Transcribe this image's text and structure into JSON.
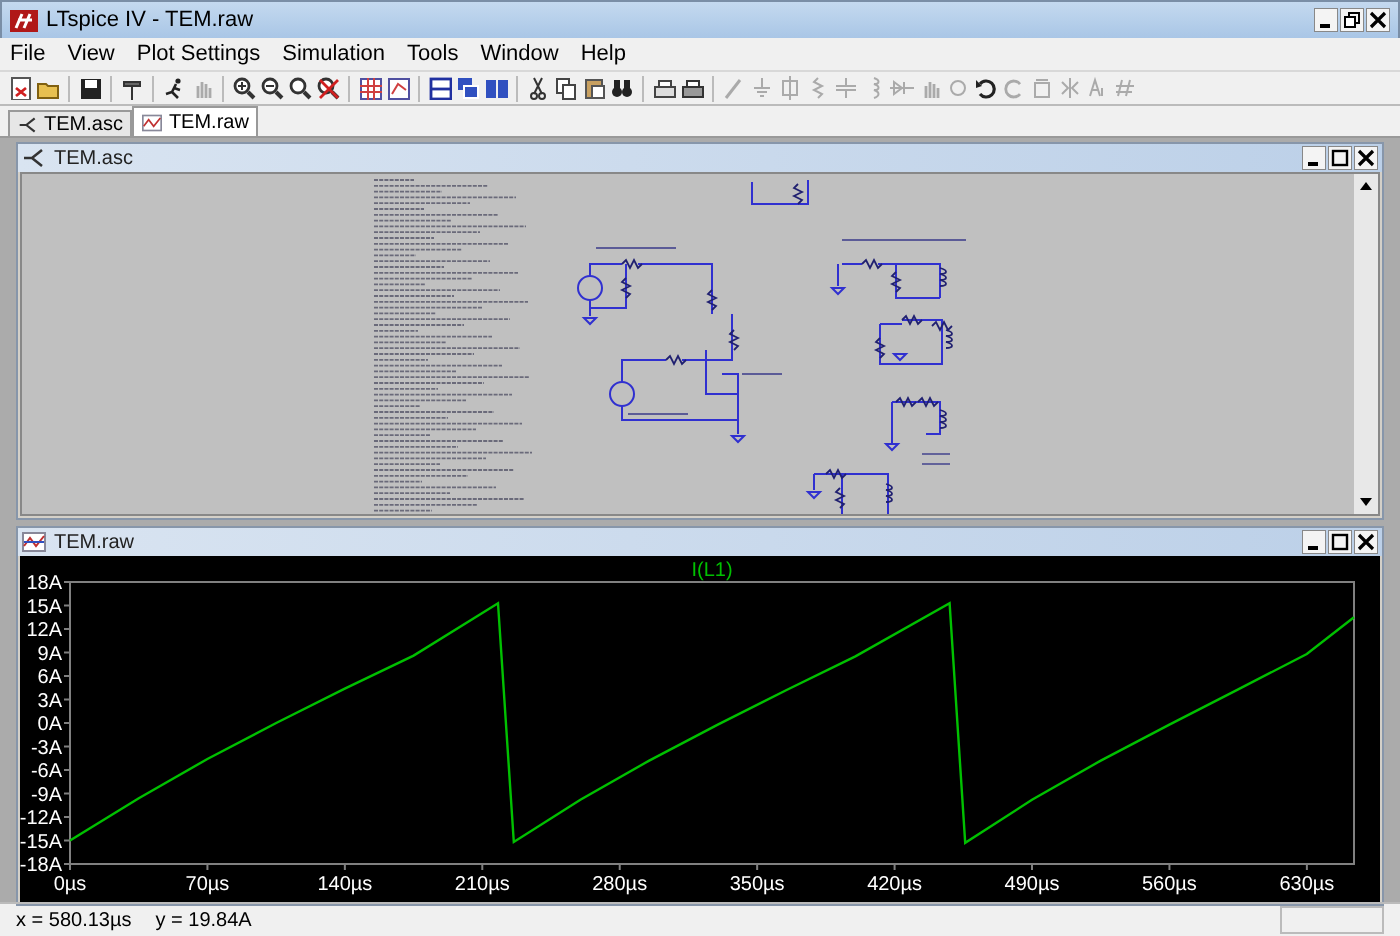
{
  "window": {
    "title": "LTspice IV - TEM.raw"
  },
  "menu": [
    {
      "label": "File"
    },
    {
      "label": "View"
    },
    {
      "label": "Plot Settings"
    },
    {
      "label": "Simulation"
    },
    {
      "label": "Tools"
    },
    {
      "label": "Window"
    },
    {
      "label": "Help"
    }
  ],
  "tabs": [
    {
      "label": "TEM.asc",
      "kind": "schematic",
      "selected": false
    },
    {
      "label": "TEM.raw",
      "kind": "plot",
      "selected": true
    }
  ],
  "schematic_window": {
    "title": "TEM.asc"
  },
  "plot_window": {
    "title": "TEM.raw",
    "chart_data": {
      "type": "line",
      "xlim": [
        0,
        654
      ],
      "ylim": [
        -18,
        18
      ],
      "xticks": [
        {
          "value": 0,
          "label": "0µs"
        },
        {
          "value": 70,
          "label": "70µs"
        },
        {
          "value": 140,
          "label": "140µs"
        },
        {
          "value": 210,
          "label": "210µs"
        },
        {
          "value": 280,
          "label": "280µs"
        },
        {
          "value": 350,
          "label": "350µs"
        },
        {
          "value": 420,
          "label": "420µs"
        },
        {
          "value": 490,
          "label": "490µs"
        },
        {
          "value": 560,
          "label": "560µs"
        },
        {
          "value": 630,
          "label": "630µs"
        }
      ],
      "yticks": [
        {
          "value": 18,
          "label": "18A"
        },
        {
          "value": 15,
          "label": "15A"
        },
        {
          "value": 12,
          "label": "12A"
        },
        {
          "value": 9,
          "label": "9A"
        },
        {
          "value": 6,
          "label": "6A"
        },
        {
          "value": 3,
          "label": "3A"
        },
        {
          "value": 0,
          "label": "0A"
        },
        {
          "value": -3,
          "label": "-3A"
        },
        {
          "value": -6,
          "label": "-6A"
        },
        {
          "value": -9,
          "label": "-9A"
        },
        {
          "value": -12,
          "label": "-12A"
        },
        {
          "value": -15,
          "label": "-15A"
        },
        {
          "value": -18,
          "label": "-18A"
        }
      ],
      "x": [
        0,
        35,
        70,
        105,
        140,
        175,
        218,
        226,
        260,
        295,
        330,
        365,
        400,
        448,
        456,
        490,
        525,
        560,
        595,
        630,
        654
      ],
      "series": [
        {
          "name": "I(L1)",
          "color": "#00c000",
          "values": [
            -15,
            -9.6,
            -4.6,
            0,
            4.4,
            8.6,
            15.3,
            -15.2,
            -9.8,
            -4.8,
            -0.2,
            4.2,
            8.5,
            15.3,
            -15.3,
            -9.8,
            -4.8,
            -0.2,
            4.3,
            8.8,
            13.5
          ]
        }
      ]
    }
  },
  "status_bar": {
    "cursor_x": "x = 580.13µs",
    "cursor_y": "y = 19.84A"
  }
}
